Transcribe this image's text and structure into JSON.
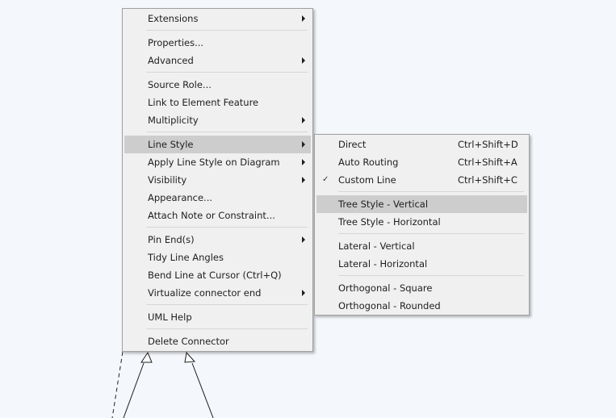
{
  "main_menu": {
    "items": [
      {
        "label": "Extensions",
        "submenu": true
      },
      {
        "separator": true
      },
      {
        "label": "Properties...",
        "submenu": false
      },
      {
        "label": "Advanced",
        "submenu": true
      },
      {
        "separator": true
      },
      {
        "label": "Source Role...",
        "submenu": false
      },
      {
        "label": "Link to Element Feature",
        "submenu": false
      },
      {
        "label": "Multiplicity",
        "submenu": true
      },
      {
        "separator": true
      },
      {
        "label": "Line Style",
        "submenu": true,
        "highlighted": true
      },
      {
        "label": "Apply Line Style on Diagram",
        "submenu": true
      },
      {
        "label": "Visibility",
        "submenu": true
      },
      {
        "label": "Appearance...",
        "submenu": false
      },
      {
        "label": "Attach Note or Constraint...",
        "submenu": false
      },
      {
        "separator": true
      },
      {
        "label": "Pin End(s)",
        "submenu": true
      },
      {
        "label": "Tidy Line Angles",
        "submenu": false
      },
      {
        "label": "Bend Line at Cursor (Ctrl+Q)",
        "submenu": false
      },
      {
        "label": "Virtualize connector end",
        "submenu": true
      },
      {
        "separator": true
      },
      {
        "label": "UML Help",
        "submenu": false
      },
      {
        "separator": true
      },
      {
        "label": "Delete Connector",
        "submenu": false
      }
    ]
  },
  "line_style_submenu": {
    "items": [
      {
        "label": "Direct",
        "shortcut": "Ctrl+Shift+D"
      },
      {
        "label": "Auto Routing",
        "shortcut": "Ctrl+Shift+A"
      },
      {
        "label": "Custom Line",
        "shortcut": "Ctrl+Shift+C",
        "checked": true
      },
      {
        "separator": true
      },
      {
        "label": "Tree Style - Vertical",
        "highlighted": true
      },
      {
        "label": "Tree Style - Horizontal"
      },
      {
        "separator": true
      },
      {
        "label": "Lateral - Vertical"
      },
      {
        "label": "Lateral - Horizontal"
      },
      {
        "separator": true
      },
      {
        "label": "Orthogonal - Square"
      },
      {
        "label": "Orthogonal - Rounded"
      }
    ]
  },
  "colors": {
    "canvas_background": "#f4f7fb",
    "menu_background": "#f0f0f0",
    "highlight": "#cdcdcd",
    "menu_border": "#a0a0a0"
  }
}
